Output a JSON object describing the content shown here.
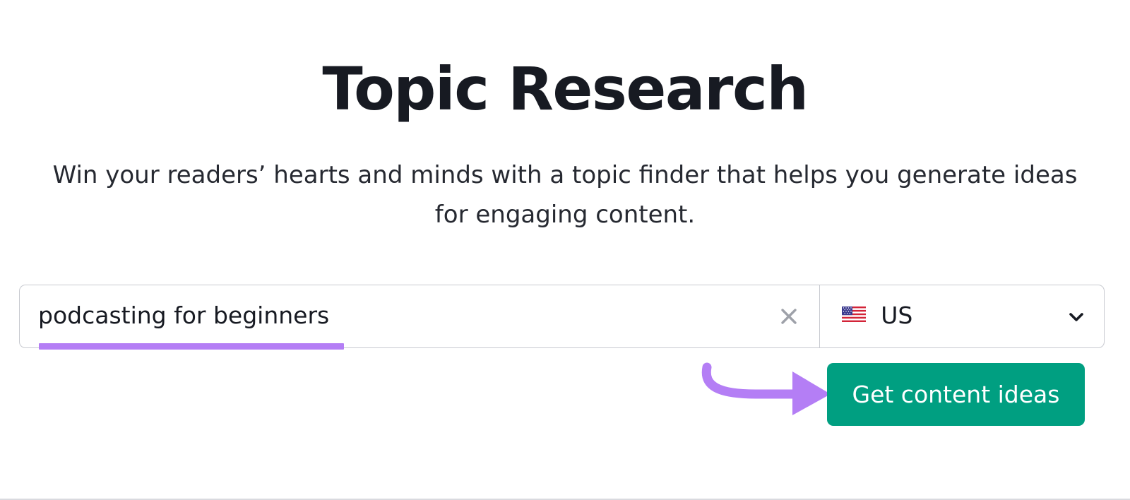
{
  "header": {
    "title": "Topic Research",
    "subtitle": "Win your readers’ hearts and minds with a topic finder that helps you generate ideas for engaging content."
  },
  "search": {
    "value": "podcasting for beginners",
    "clear_icon": "close-icon",
    "highlight_color": "#b47ef5"
  },
  "country": {
    "label": "US",
    "flag_icon": "us-flag-icon",
    "dropdown_icon": "chevron-down-icon"
  },
  "cta": {
    "label": "Get content ideas",
    "color": "#009f81",
    "pointer_icon": "curved-arrow-icon",
    "pointer_color": "#b47ef5"
  }
}
